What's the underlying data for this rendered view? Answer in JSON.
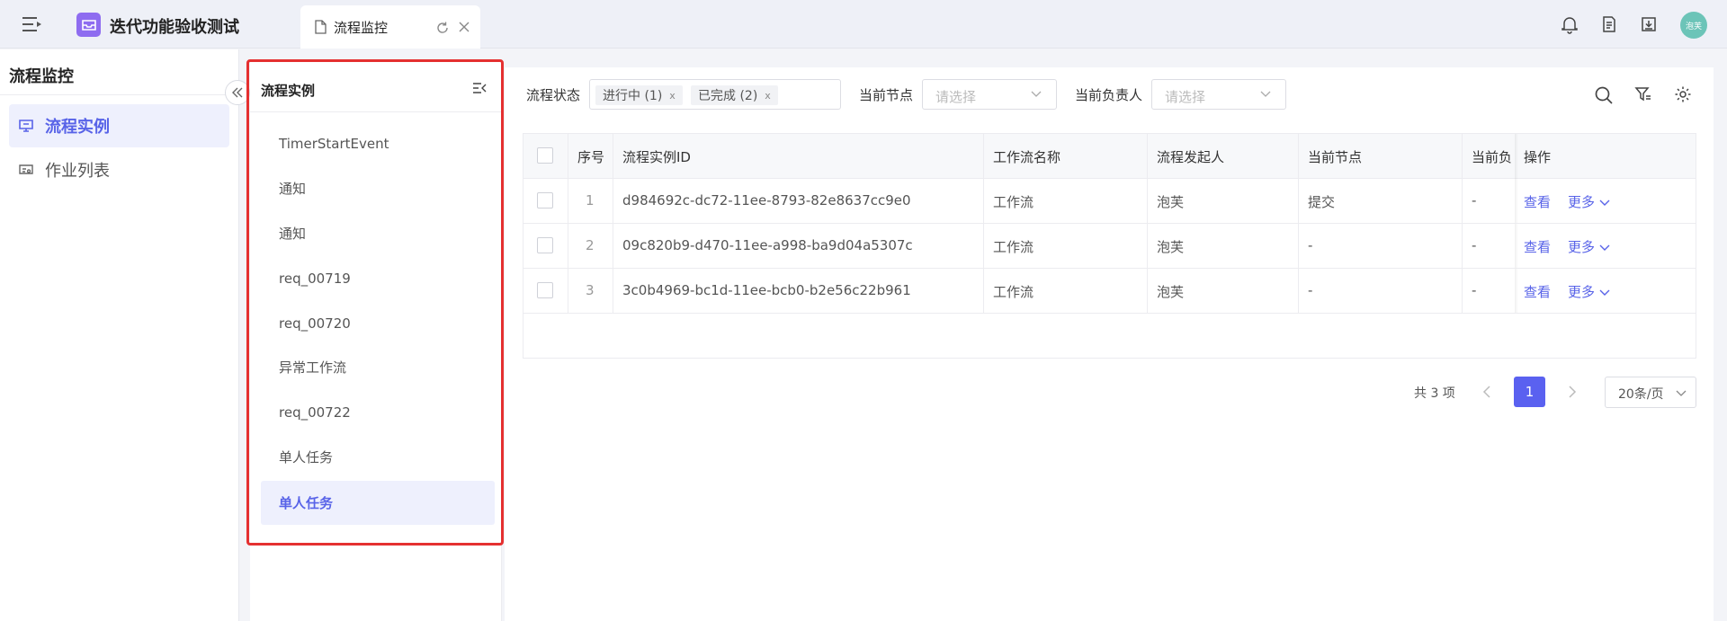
{
  "app": {
    "title": "迭代功能验收测试",
    "user_avatar": "泡芙"
  },
  "tab": {
    "label": "流程监控"
  },
  "topbar_icons": [
    "bell-icon",
    "document-icon",
    "download-box-icon"
  ],
  "leftnav": {
    "title": "流程监控",
    "items": [
      {
        "label": "流程实例",
        "icon": "monitor-icon",
        "active": true
      },
      {
        "label": "作业列表",
        "icon": "job-icon",
        "active": false
      }
    ]
  },
  "panel": {
    "title": "流程实例",
    "items": [
      {
        "label": "TimerStartEvent",
        "active": false
      },
      {
        "label": "通知",
        "active": false
      },
      {
        "label": "通知",
        "active": false
      },
      {
        "label": "req_00719",
        "active": false
      },
      {
        "label": "req_00720",
        "active": false
      },
      {
        "label": "异常工作流",
        "active": false
      },
      {
        "label": "req_00722",
        "active": false
      },
      {
        "label": "单人任务",
        "active": false
      },
      {
        "label": "单人任务",
        "active": true
      }
    ]
  },
  "filters": {
    "status_label": "流程状态",
    "status_chips": [
      "进行中 (1)",
      "已完成 (2)"
    ],
    "chip_remove": "x",
    "node_label": "当前节点",
    "node_placeholder": "请选择",
    "owner_label": "当前负责人",
    "owner_placeholder": "请选择"
  },
  "table": {
    "headers": {
      "index": "序号",
      "id": "流程实例ID",
      "workflow": "工作流名称",
      "initiator": "流程发起人",
      "node": "当前节点",
      "owner": "当前负",
      "actions": "操作"
    },
    "rows": [
      {
        "index": "1",
        "id": "d984692c-dc72-11ee-8793-82e8637cc9e0",
        "workflow": "工作流",
        "initiator": "泡芙",
        "node": "提交",
        "owner": "-"
      },
      {
        "index": "2",
        "id": "09c820b9-d470-11ee-a998-ba9d04a5307c",
        "workflow": "工作流",
        "initiator": "泡芙",
        "node": "-",
        "owner": "-"
      },
      {
        "index": "3",
        "id": "3c0b4969-bc1d-11ee-bcb0-b2e56c22b961",
        "workflow": "工作流",
        "initiator": "泡芙",
        "node": "-",
        "owner": "-"
      }
    ],
    "action_view": "查看",
    "action_more": "更多"
  },
  "pagination": {
    "total": "共 3 项",
    "current_page": "1",
    "page_size": "20条/页"
  },
  "colors": {
    "accent": "#5a61f0",
    "highlight": "#e53030",
    "logo": "#8e6cf0"
  }
}
